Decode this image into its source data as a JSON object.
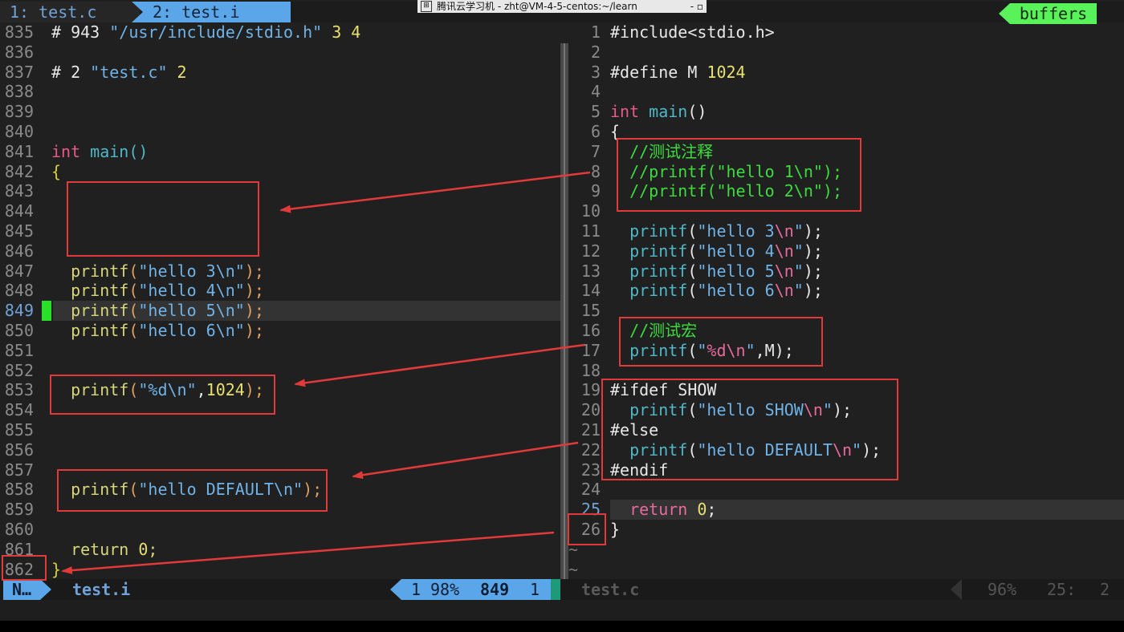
{
  "window_title": "腾讯云学习机 - zht@VM-4-5-centos:~/learn",
  "tabs": [
    {
      "label": "1: test.c"
    },
    {
      "label": "2: test.i"
    }
  ],
  "buffers_label": "buffers",
  "left_pane": {
    "filename": "test.i",
    "lines": [
      {
        "num": "835",
        "tokens": [
          {
            "t": "# 943 ",
            "c": "c-def"
          },
          {
            "t": "\"/usr/include/stdio.h\"",
            "c": "c-str"
          },
          {
            "t": " 3 4",
            "c": "c-num"
          }
        ]
      },
      {
        "num": "836",
        "tokens": []
      },
      {
        "num": "837",
        "tokens": [
          {
            "t": "# 2 ",
            "c": "c-def"
          },
          {
            "t": "\"test.c\"",
            "c": "c-str"
          },
          {
            "t": " 2",
            "c": "c-num"
          }
        ]
      },
      {
        "num": "838",
        "tokens": []
      },
      {
        "num": "839",
        "tokens": []
      },
      {
        "num": "840",
        "tokens": []
      },
      {
        "num": "841",
        "tokens": [
          {
            "t": "int",
            "c": "c-type"
          },
          {
            "t": " ",
            "c": "c-def"
          },
          {
            "t": "main",
            "c": "c-fn"
          },
          {
            "t": "()",
            "c": "c-fn"
          }
        ]
      },
      {
        "num": "842",
        "tokens": [
          {
            "t": "{",
            "c": "c-pre"
          }
        ]
      },
      {
        "num": "843",
        "tokens": []
      },
      {
        "num": "844",
        "tokens": []
      },
      {
        "num": "845",
        "tokens": []
      },
      {
        "num": "846",
        "tokens": []
      },
      {
        "num": "847",
        "tokens": [
          {
            "t": "  printf",
            "c": "c-lfn"
          },
          {
            "t": "(",
            "c": "c-paren"
          },
          {
            "t": "\"hello 3\\n\"",
            "c": "c-str"
          },
          {
            "t": ");",
            "c": "c-paren"
          }
        ]
      },
      {
        "num": "848",
        "tokens": [
          {
            "t": "  printf",
            "c": "c-lfn"
          },
          {
            "t": "(",
            "c": "c-paren"
          },
          {
            "t": "\"hello 4\\n\"",
            "c": "c-str"
          },
          {
            "t": ");",
            "c": "c-paren"
          }
        ]
      },
      {
        "num": "849",
        "current": true,
        "tokens": [
          {
            "t": "  printf",
            "c": "c-lfn"
          },
          {
            "t": "(",
            "c": "c-paren"
          },
          {
            "t": "\"hello 5\\n\"",
            "c": "c-str"
          },
          {
            "t": ");",
            "c": "c-paren"
          }
        ]
      },
      {
        "num": "850",
        "tokens": [
          {
            "t": "  printf",
            "c": "c-lfn"
          },
          {
            "t": "(",
            "c": "c-paren"
          },
          {
            "t": "\"hello 6\\n\"",
            "c": "c-str"
          },
          {
            "t": ");",
            "c": "c-paren"
          }
        ]
      },
      {
        "num": "851",
        "tokens": []
      },
      {
        "num": "852",
        "tokens": []
      },
      {
        "num": "853",
        "tokens": [
          {
            "t": "  printf",
            "c": "c-lfn"
          },
          {
            "t": "(",
            "c": "c-paren"
          },
          {
            "t": "\"%d\\n\"",
            "c": "c-str"
          },
          {
            "t": ",",
            "c": "c-def"
          },
          {
            "t": "1024",
            "c": "c-num"
          },
          {
            "t": ");",
            "c": "c-paren"
          }
        ]
      },
      {
        "num": "854",
        "tokens": []
      },
      {
        "num": "855",
        "tokens": []
      },
      {
        "num": "856",
        "tokens": []
      },
      {
        "num": "857",
        "tokens": []
      },
      {
        "num": "858",
        "tokens": [
          {
            "t": "  printf",
            "c": "c-lfn"
          },
          {
            "t": "(",
            "c": "c-paren"
          },
          {
            "t": "\"hello DEFAULT\\n\"",
            "c": "c-str"
          },
          {
            "t": ");",
            "c": "c-paren"
          }
        ]
      },
      {
        "num": "859",
        "tokens": []
      },
      {
        "num": "860",
        "tokens": []
      },
      {
        "num": "861",
        "tokens": [
          {
            "t": "  return",
            "c": "c-lfn"
          },
          {
            "t": " ",
            "c": "c-def"
          },
          {
            "t": "0",
            "c": "c-num"
          },
          {
            "t": ";",
            "c": "c-lfn"
          }
        ]
      },
      {
        "num": "862",
        "tokens": [
          {
            "t": "}",
            "c": "c-pre"
          }
        ]
      }
    ]
  },
  "right_pane": {
    "filename": "test.c",
    "lines": [
      {
        "num": "1",
        "tokens": [
          {
            "t": "#include<stdio.h>",
            "c": "c-def"
          }
        ]
      },
      {
        "num": "2",
        "tokens": []
      },
      {
        "num": "3",
        "tokens": [
          {
            "t": "#define M ",
            "c": "c-def"
          },
          {
            "t": "1024",
            "c": "c-num"
          }
        ]
      },
      {
        "num": "4",
        "tokens": []
      },
      {
        "num": "5",
        "tokens": [
          {
            "t": "int",
            "c": "c-type"
          },
          {
            "t": " ",
            "c": "c-def"
          },
          {
            "t": "main",
            "c": "c-fn"
          },
          {
            "t": "()",
            "c": "c-def"
          }
        ]
      },
      {
        "num": "6",
        "tokens": [
          {
            "t": "{",
            "c": "c-def"
          }
        ]
      },
      {
        "num": "7",
        "tokens": [
          {
            "t": "  //测试注释",
            "c": "c-com"
          }
        ]
      },
      {
        "num": "8",
        "tokens": [
          {
            "t": "  //printf(\"hello 1\\n\");",
            "c": "c-com"
          }
        ]
      },
      {
        "num": "9",
        "tokens": [
          {
            "t": "  //printf(\"hello 2\\n\");",
            "c": "c-com"
          }
        ]
      },
      {
        "num": "10",
        "tokens": []
      },
      {
        "num": "11",
        "tokens": [
          {
            "t": "  printf",
            "c": "c-fn"
          },
          {
            "t": "(",
            "c": "c-def"
          },
          {
            "t": "\"hello 3",
            "c": "c-str"
          },
          {
            "t": "\\n",
            "c": "c-esc"
          },
          {
            "t": "\"",
            "c": "c-str"
          },
          {
            "t": ");",
            "c": "c-def"
          }
        ]
      },
      {
        "num": "12",
        "tokens": [
          {
            "t": "  printf",
            "c": "c-fn"
          },
          {
            "t": "(",
            "c": "c-def"
          },
          {
            "t": "\"hello 4",
            "c": "c-str"
          },
          {
            "t": "\\n",
            "c": "c-esc"
          },
          {
            "t": "\"",
            "c": "c-str"
          },
          {
            "t": ");",
            "c": "c-def"
          }
        ]
      },
      {
        "num": "13",
        "tokens": [
          {
            "t": "  printf",
            "c": "c-fn"
          },
          {
            "t": "(",
            "c": "c-def"
          },
          {
            "t": "\"hello 5",
            "c": "c-str"
          },
          {
            "t": "\\n",
            "c": "c-esc"
          },
          {
            "t": "\"",
            "c": "c-str"
          },
          {
            "t": ");",
            "c": "c-def"
          }
        ]
      },
      {
        "num": "14",
        "tokens": [
          {
            "t": "  printf",
            "c": "c-fn"
          },
          {
            "t": "(",
            "c": "c-def"
          },
          {
            "t": "\"hello 6",
            "c": "c-str"
          },
          {
            "t": "\\n",
            "c": "c-esc"
          },
          {
            "t": "\"",
            "c": "c-str"
          },
          {
            "t": ");",
            "c": "c-def"
          }
        ]
      },
      {
        "num": "15",
        "tokens": []
      },
      {
        "num": "16",
        "tokens": [
          {
            "t": "  //测试宏",
            "c": "c-com"
          }
        ]
      },
      {
        "num": "17",
        "tokens": [
          {
            "t": "  printf",
            "c": "c-fn"
          },
          {
            "t": "(",
            "c": "c-def"
          },
          {
            "t": "\"",
            "c": "c-str"
          },
          {
            "t": "%d\\n",
            "c": "c-esc"
          },
          {
            "t": "\"",
            "c": "c-str"
          },
          {
            "t": ",M);",
            "c": "c-def"
          }
        ]
      },
      {
        "num": "18",
        "tokens": []
      },
      {
        "num": "19",
        "tokens": [
          {
            "t": "#ifdef SHOW",
            "c": "c-def"
          }
        ]
      },
      {
        "num": "20",
        "tokens": [
          {
            "t": "  printf",
            "c": "c-fn"
          },
          {
            "t": "(",
            "c": "c-def"
          },
          {
            "t": "\"hello SHOW",
            "c": "c-str"
          },
          {
            "t": "\\n",
            "c": "c-esc"
          },
          {
            "t": "\"",
            "c": "c-str"
          },
          {
            "t": ");",
            "c": "c-def"
          }
        ]
      },
      {
        "num": "21",
        "tokens": [
          {
            "t": "#else",
            "c": "c-def"
          }
        ]
      },
      {
        "num": "22",
        "tokens": [
          {
            "t": "  printf",
            "c": "c-fn"
          },
          {
            "t": "(",
            "c": "c-def"
          },
          {
            "t": "\"hello DEFAULT",
            "c": "c-str"
          },
          {
            "t": "\\n",
            "c": "c-esc"
          },
          {
            "t": "\"",
            "c": "c-str"
          },
          {
            "t": ");",
            "c": "c-def"
          }
        ]
      },
      {
        "num": "23",
        "tokens": [
          {
            "t": "#endif",
            "c": "c-def"
          }
        ]
      },
      {
        "num": "24",
        "tokens": []
      },
      {
        "num": "25",
        "current": true,
        "tokens": [
          {
            "t": "  return",
            "c": "c-ret"
          },
          {
            "t": " ",
            "c": "c-def"
          },
          {
            "t": "0",
            "c": "c-num"
          },
          {
            "t": ";",
            "c": "c-def"
          }
        ]
      },
      {
        "num": "26",
        "tokens": [
          {
            "t": "}",
            "c": "c-def"
          }
        ]
      }
    ],
    "tildes": [
      "~",
      "~"
    ]
  },
  "statusline": {
    "mode": "N…",
    "left_file": "test.i",
    "left_pos": {
      "a": "1",
      "pct": "98%",
      "line": "849",
      "col": "1"
    },
    "right_file": "test.c",
    "right_pos": {
      "pct": "96%",
      "line": "25:",
      "col": "2"
    }
  },
  "colors": {
    "accent_blue": "#5aa6e8",
    "buffers_green": "#5af25a",
    "annotation_red": "#e23a3a",
    "comment_green": "#3ddc3d",
    "sign_green": "#28e028"
  },
  "icons": [
    "window-icon",
    "minimize-icon",
    "restore-icon"
  ]
}
